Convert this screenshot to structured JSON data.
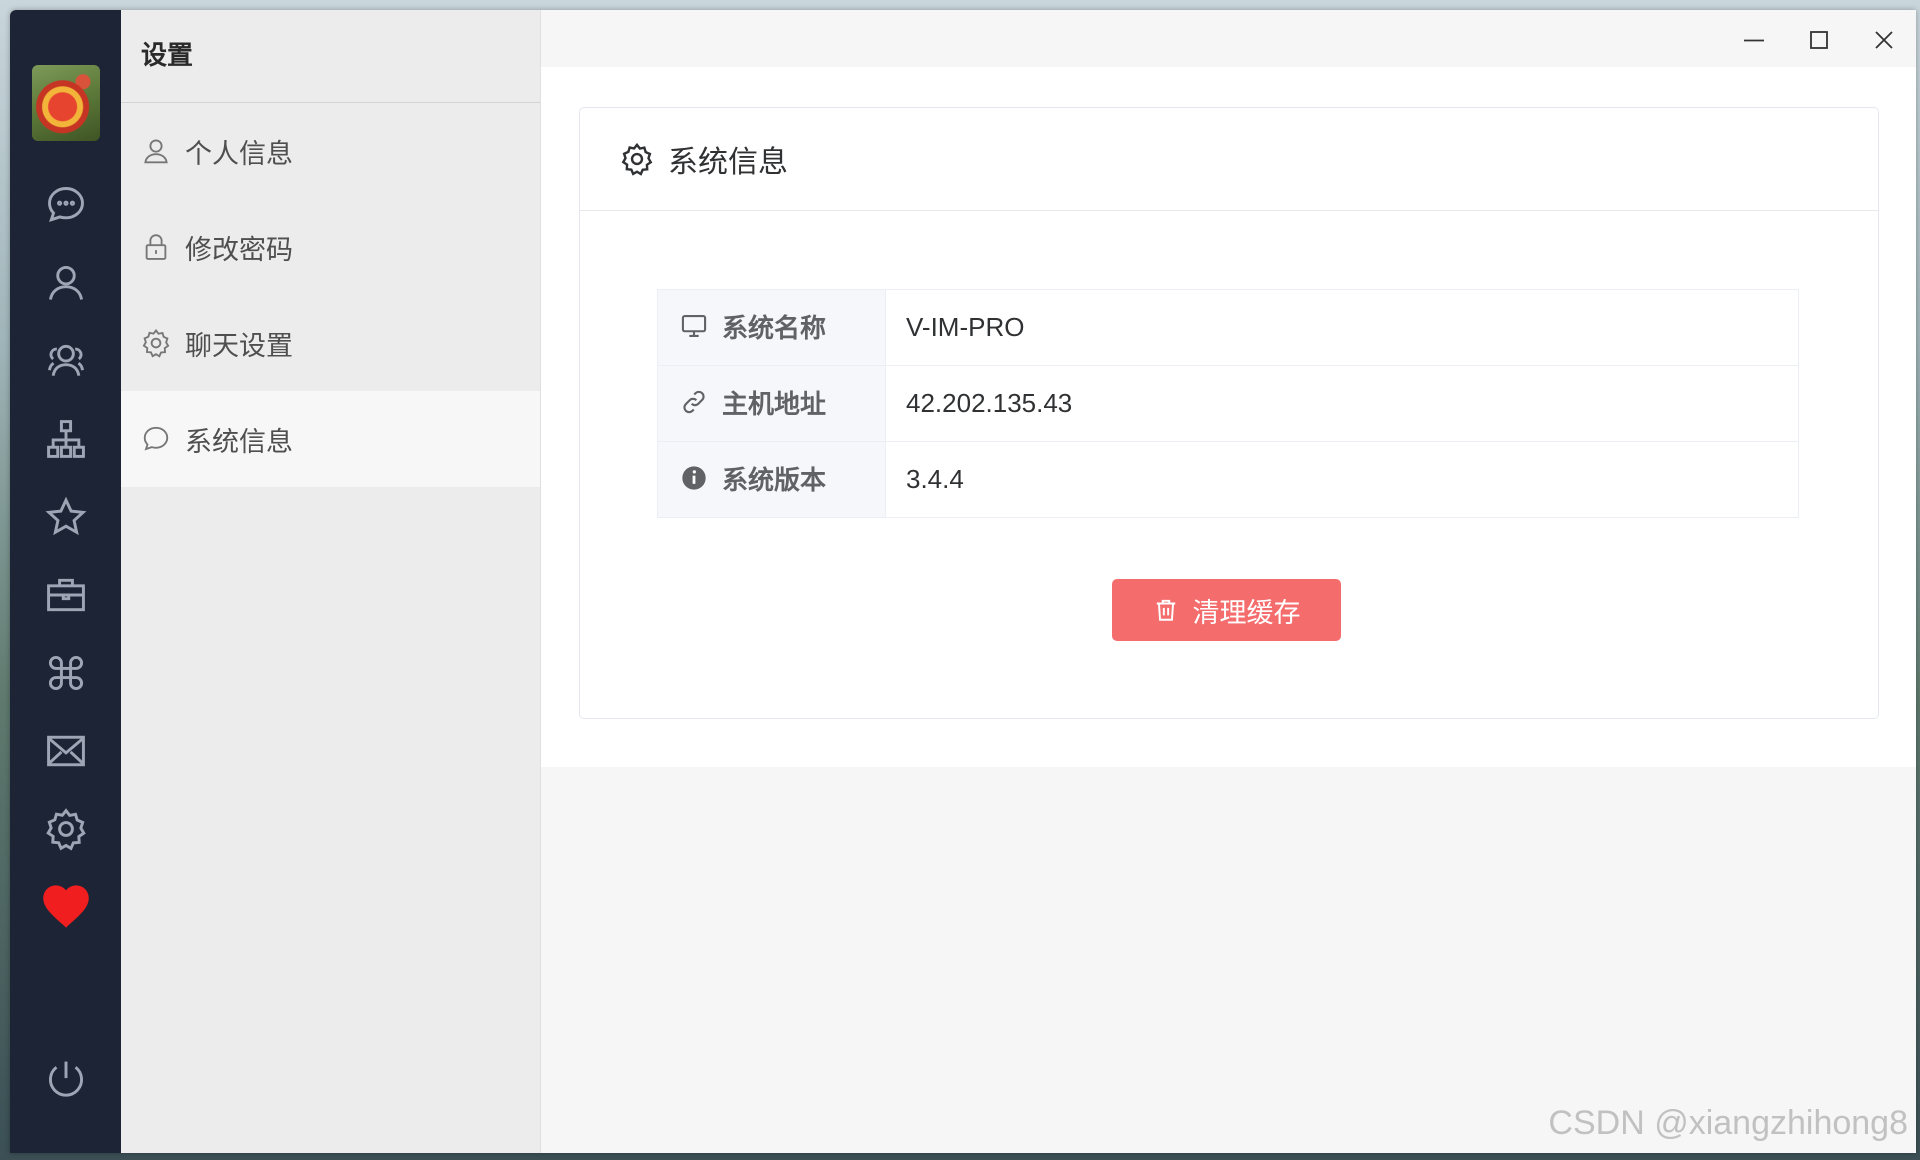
{
  "menu": {
    "title": "设置",
    "items": [
      {
        "label": "个人信息",
        "icon": "user-icon"
      },
      {
        "label": "修改密码",
        "icon": "lock-icon"
      },
      {
        "label": "聊天设置",
        "icon": "gear-icon"
      },
      {
        "label": "系统信息",
        "icon": "chat-bubble-icon",
        "active": true
      }
    ]
  },
  "rail": {
    "icons": [
      "chat-icon",
      "user-icon",
      "group-icon",
      "org-tree-icon",
      "star-icon",
      "briefcase-icon",
      "apps-icon",
      "mail-icon",
      "settings-icon",
      "heart-icon",
      "power-icon"
    ]
  },
  "card": {
    "title": "系统信息",
    "rows": [
      {
        "label": "系统名称",
        "value": "V-IM-PRO",
        "icon": "monitor-icon"
      },
      {
        "label": "主机地址",
        "value": "42.202.135.43",
        "icon": "link-icon"
      },
      {
        "label": "系统版本",
        "value": "3.4.4",
        "icon": "info-icon"
      }
    ],
    "clear_label": "清理缓存"
  },
  "watermark": "CSDN @xiangzhihong8",
  "colors": {
    "rail": "#1d2436",
    "danger": "#f56c6c",
    "heart": "#f01e1e"
  }
}
